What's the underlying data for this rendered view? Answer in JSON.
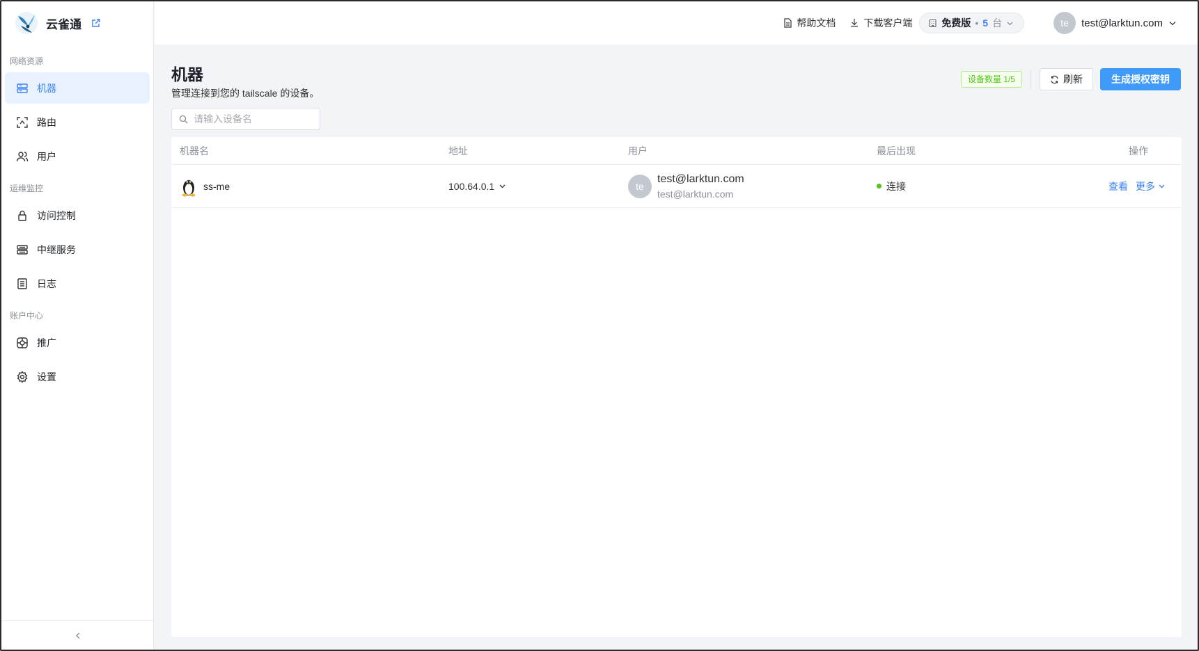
{
  "brand": {
    "name": "云雀通",
    "logo_icon": "lark-bird-logo",
    "external_icon": "external-link-icon"
  },
  "sidebar": {
    "sections": [
      {
        "label": "网络资源",
        "items": [
          {
            "label": "机器",
            "icon": "server-icon",
            "active": true
          },
          {
            "label": "路由",
            "icon": "route-scan-icon",
            "active": false
          },
          {
            "label": "用户",
            "icon": "users-icon",
            "active": false
          }
        ]
      },
      {
        "label": "运维监控",
        "items": [
          {
            "label": "访问控制",
            "icon": "lock-icon",
            "active": false
          },
          {
            "label": "中继服务",
            "icon": "relay-server-icon",
            "active": false
          },
          {
            "label": "日志",
            "icon": "log-icon",
            "active": false
          }
        ]
      },
      {
        "label": "账户中心",
        "items": [
          {
            "label": "推广",
            "icon": "promote-icon",
            "active": false
          },
          {
            "label": "设置",
            "icon": "gear-icon",
            "active": false
          }
        ]
      }
    ],
    "collapse_icon": "chevron-left-icon"
  },
  "header": {
    "help_docs": "帮助文档",
    "download_client": "下载客户端",
    "plan": {
      "name": "免费版",
      "separator": "•",
      "count": "5",
      "unit": "台"
    },
    "user": {
      "avatar_text": "te",
      "email": "test@larktun.com"
    }
  },
  "page": {
    "title": "机器",
    "subtitle": "管理连接到您的 tailscale 的设备。",
    "device_count_tag": "设备数量 1/5",
    "refresh_label": "刷新",
    "generate_key_label": "生成授权密钥",
    "search_placeholder": "请输入设备名"
  },
  "table": {
    "columns": [
      "机器名",
      "地址",
      "用户",
      "最后出现",
      "操作"
    ],
    "rows": [
      {
        "os_icon": "linux-tux-icon",
        "name": "ss-me",
        "address": "100.64.0.1",
        "user_avatar": "te",
        "user_name": "test@larktun.com",
        "user_email": "test@larktun.com",
        "status": "连接",
        "status_color": "#52c41a",
        "action_view": "查看",
        "action_more": "更多"
      }
    ]
  },
  "colors": {
    "accent": "#3f9bf7",
    "active_nav_bg": "#e8f2ff",
    "success": "#52c41a"
  }
}
